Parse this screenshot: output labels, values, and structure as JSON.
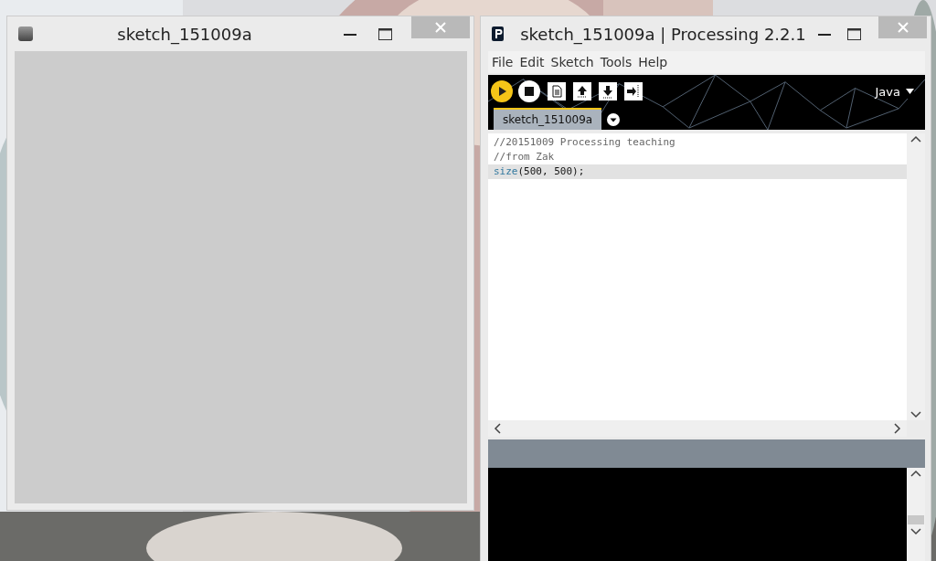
{
  "sketch_window": {
    "title": "sketch_151009a"
  },
  "ide_window": {
    "title": "sketch_151009a | Processing 2.2.1",
    "menu": [
      "File",
      "Edit",
      "Sketch",
      "Tools",
      "Help"
    ],
    "toolbar": [
      {
        "kind": "run"
      },
      {
        "kind": "stop"
      },
      {
        "kind": "new"
      },
      {
        "kind": "open"
      },
      {
        "kind": "save"
      },
      {
        "kind": "export"
      }
    ],
    "mode": "Java",
    "tabs": [
      {
        "label": "sketch_151009a",
        "selected": true
      }
    ],
    "code_lines": [
      {
        "selected": false,
        "segments": [
          {
            "kind": "comment",
            "text": "//20151009 Processing teaching"
          }
        ]
      },
      {
        "selected": false,
        "segments": [
          {
            "kind": "comment",
            "text": "//from Zak"
          }
        ]
      },
      {
        "selected": true,
        "segments": [
          {
            "kind": "keyword",
            "text": "size"
          },
          {
            "kind": "plain",
            "text": "(500, 500);"
          }
        ]
      }
    ]
  }
}
